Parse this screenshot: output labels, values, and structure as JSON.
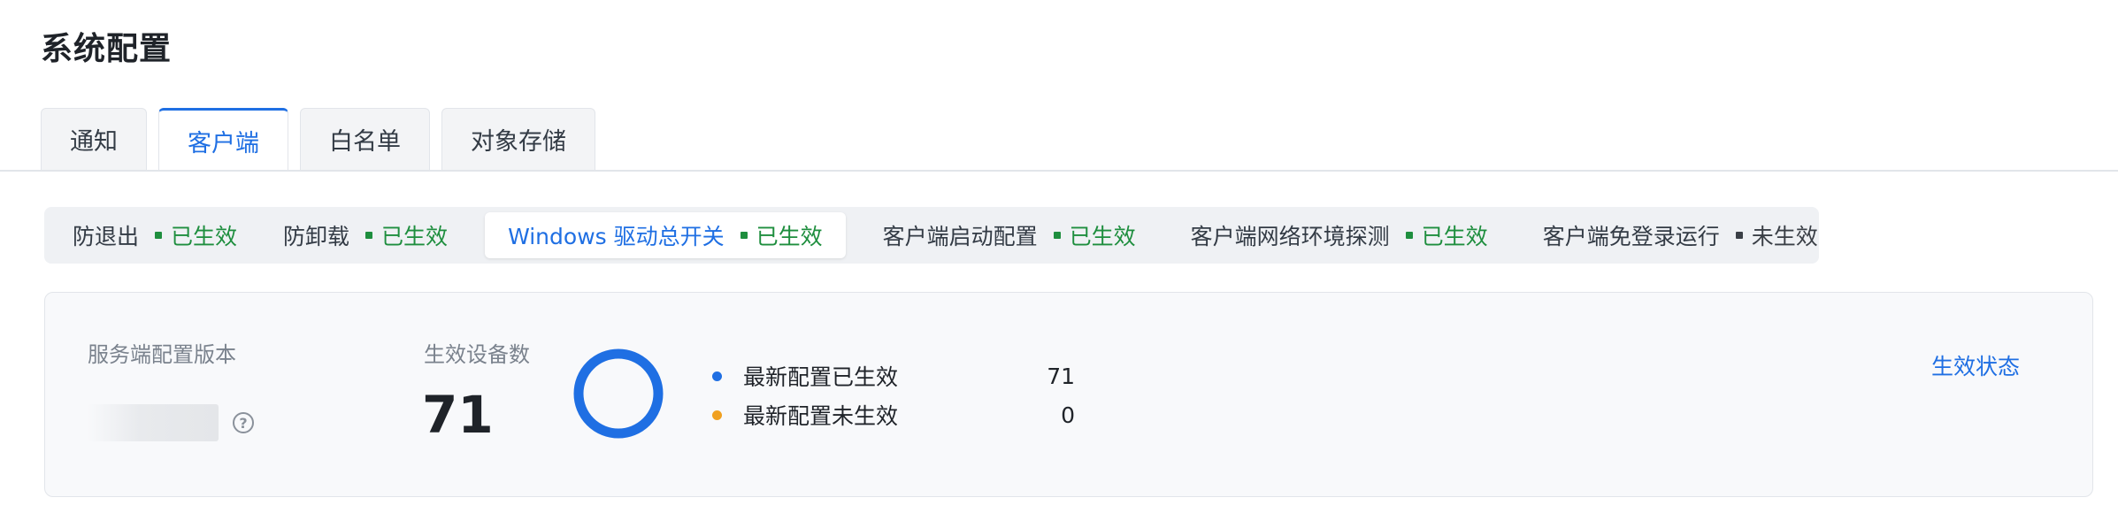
{
  "page": {
    "title": "系统配置"
  },
  "top_tabs": [
    {
      "label": "通知",
      "active": false
    },
    {
      "label": "客户端",
      "active": true
    },
    {
      "label": "白名单",
      "active": false
    },
    {
      "label": "对象存储",
      "active": false
    }
  ],
  "sub_tabs": [
    {
      "label": "防退出",
      "status": "已生效",
      "status_color": "#1e8e3e",
      "active": false
    },
    {
      "label": "防卸载",
      "status": "已生效",
      "status_color": "#1e8e3e",
      "active": false
    },
    {
      "label": "Windows 驱动总开关",
      "status": "已生效",
      "status_color": "#1e8e3e",
      "active": true
    },
    {
      "label": "客户端启动配置",
      "status": "已生效",
      "status_color": "#1e8e3e",
      "active": false
    },
    {
      "label": "客户端网络环境探测",
      "status": "已生效",
      "status_color": "#1e8e3e",
      "active": false
    },
    {
      "label": "客户端免登录运行",
      "status": "未生效",
      "status_color": "#3a3f46",
      "active": false
    }
  ],
  "card": {
    "version_label": "服务端配置版本",
    "help_icon": "question-circle-icon",
    "devices_label": "生效设备数",
    "devices_count": "71",
    "donut_colors": {
      "effective": "#1f6fe3",
      "not_effective": "#f0a020"
    },
    "legend": [
      {
        "label": "最新配置已生效",
        "value": "71",
        "color": "#1f6fe3"
      },
      {
        "label": "最新配置未生效",
        "value": "0",
        "color": "#f0a020"
      }
    ],
    "status_link": "生效状态"
  }
}
